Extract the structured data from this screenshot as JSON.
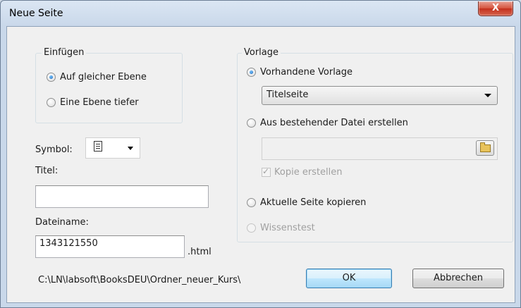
{
  "window": {
    "title": "Neue Seite",
    "close_label": "X"
  },
  "einfuegen": {
    "legend": "Einfügen",
    "options": [
      {
        "label": "Auf gleicher Ebene",
        "checked": true
      },
      {
        "label": "Eine Ebene tiefer",
        "checked": false
      }
    ]
  },
  "symbol": {
    "label": "Symbol:",
    "icon": "page-icon"
  },
  "titel": {
    "label": "Titel:",
    "value": ""
  },
  "dateiname": {
    "label": "Dateiname:",
    "value": "1343121550",
    "suffix": ".html"
  },
  "path": "C:\\LN\\labsoft\\BooksDEU\\Ordner_neuer_Kurs\\",
  "vorlage": {
    "legend": "Vorlage",
    "option_existing": "Vorhandene Vorlage",
    "template_selected": "Titelseite",
    "option_from_file": "Aus bestehender Datei erstellen",
    "file_value": "",
    "copy_checkbox": "Kopie erstellen",
    "option_copy_page": "Aktuelle Seite kopieren",
    "option_test": "Wissenstest"
  },
  "buttons": {
    "ok": "OK",
    "cancel": "Abbrechen"
  }
}
